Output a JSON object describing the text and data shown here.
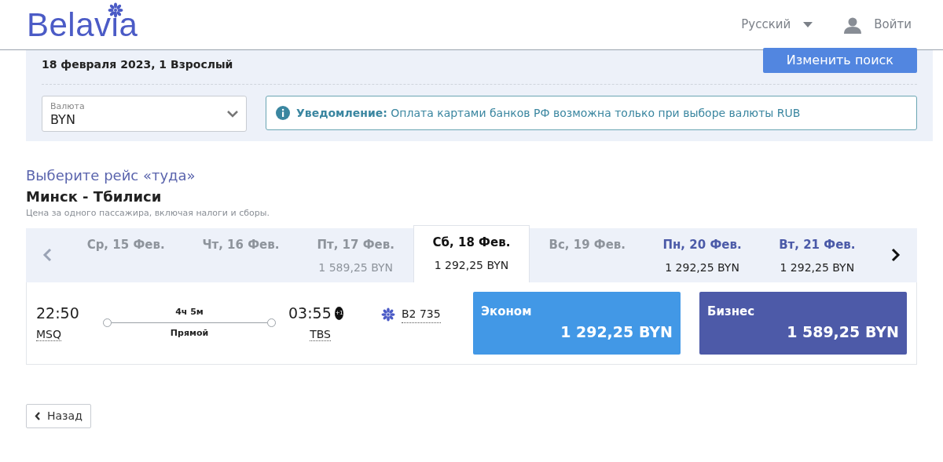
{
  "header": {
    "logo": "Belavia",
    "language": "Русский",
    "login": "Войти"
  },
  "summary": {
    "details": "18 февраля 2023, 1 Взрослый",
    "change_button": "Изменить поиск",
    "currency": {
      "label": "Валюта",
      "value": "BYN"
    },
    "notice": {
      "title": "Уведомление:",
      "text": "Оплата картами банков РФ возможна только при выборе валюты RUB"
    }
  },
  "flights": {
    "heading": "Выберите рейс «туда»",
    "route": "Минск - Тбилиси",
    "note": "Цена за одного пассажира, включая налоги и сборы.",
    "dates": [
      {
        "label": "Ср, 15 Фев.",
        "disabled": true,
        "selected": false
      },
      {
        "label": "Чт, 16 Фев.",
        "disabled": true,
        "selected": false
      },
      {
        "label": "Пт, 17 Фев.",
        "price": "1 589,25 BYN",
        "disabled": true,
        "selected": false
      },
      {
        "label": "Сб, 18 Фев.",
        "price": "1 292,25 BYN",
        "disabled": false,
        "selected": true
      },
      {
        "label": "Вс, 19 Фев.",
        "disabled": true,
        "selected": false
      },
      {
        "label": "Пн, 20 Фев.",
        "price": "1 292,25 BYN",
        "disabled": false,
        "selected": false
      },
      {
        "label": "Вт, 21 Фев.",
        "price": "1 292,25 BYN",
        "disabled": false,
        "selected": false
      }
    ],
    "flight": {
      "depart_time": "22:50",
      "depart_airport": "MSQ",
      "duration": "4ч 5м",
      "stops": "Прямой",
      "arrive_time": "03:55",
      "day_offset": "+1",
      "arrive_airport": "TBS",
      "number": "B2 735",
      "fares": [
        {
          "kind": "economy",
          "name": "Эконом",
          "price": "1 292,25 BYN"
        },
        {
          "kind": "business",
          "name": "Бизнес",
          "price": "1 589,25 BYN"
        }
      ]
    }
  },
  "back_button": "Назад"
}
